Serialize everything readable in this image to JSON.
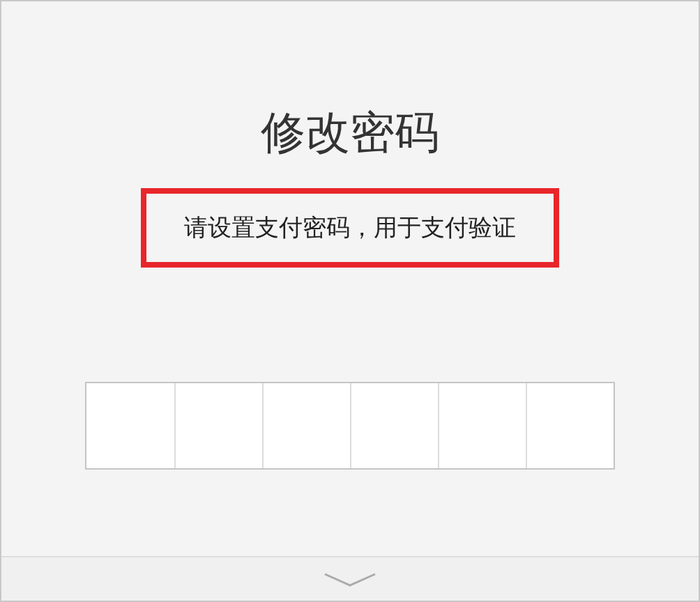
{
  "title": "修改密码",
  "subtitle": {
    "text": "请设置支付密码，用于支付验证",
    "highlighted": true
  },
  "password_cells": [
    {
      "filled": false
    },
    {
      "filled": false
    },
    {
      "filled": false
    },
    {
      "filled": false
    },
    {
      "filled": false
    },
    {
      "filled": false
    }
  ]
}
